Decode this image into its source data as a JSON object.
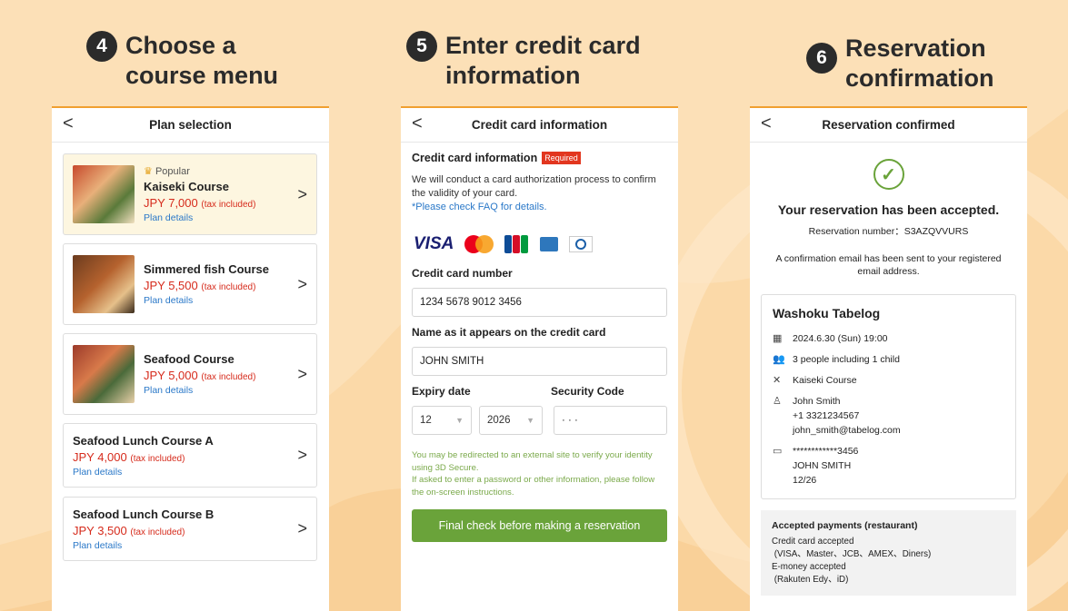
{
  "steps": [
    {
      "num": "4",
      "title": "Choose a\ncourse menu"
    },
    {
      "num": "5",
      "title": "Enter credit card\ninformation"
    },
    {
      "num": "6",
      "title": "Reservation\nconfirmation"
    }
  ],
  "plan_screen": {
    "header": "Plan selection",
    "back_icon": "chevron-left-icon",
    "plans": [
      {
        "badge": "Popular",
        "name": "Kaiseki Course",
        "price": "JPY 7,000",
        "tax": "(tax included)",
        "link": "Plan details"
      },
      {
        "name": "Simmered fish Course",
        "price": "JPY 5,500",
        "tax": "(tax included)",
        "link": "Plan details"
      },
      {
        "name": "Seafood Course",
        "price": "JPY 5,000",
        "tax": "(tax included)",
        "link": "Plan details"
      },
      {
        "name": "Seafood Lunch Course A",
        "price": "JPY 4,000",
        "tax": "(tax included)",
        "link": "Plan details"
      },
      {
        "name": "Seafood Lunch Course B",
        "price": "JPY 3,500",
        "tax": "(tax included)",
        "link": "Plan details"
      }
    ]
  },
  "card_screen": {
    "header": "Credit card information",
    "section_title": "Credit card information",
    "required": "Required",
    "desc": "We will conduct a card authorization process to confirm the validity of your card.",
    "faq": "*Please check FAQ for details.",
    "visa": "VISA",
    "number_label": "Credit card number",
    "number_value": "1234 5678 9012 3456",
    "name_label": "Name as it appears on the credit card",
    "name_value": "JOHN SMITH",
    "expiry_label": "Expiry date",
    "security_label": "Security Code",
    "month": "12",
    "year": "2026",
    "security_value": "· · ·",
    "note": "You may be redirected to an external site to verify your identity using 3D Secure.\nIf asked to enter a password or other information, please follow the on-screen instructions.",
    "button": "Final check before making a reservation"
  },
  "confirm_screen": {
    "header": "Reservation confirmed",
    "headline": "Your reservation has been accepted.",
    "reservation_number": "Reservation number：S3AZQVVURS",
    "mail_note": "A confirmation email has been sent to your registered email address.",
    "restaurant": "Washoku Tabelog",
    "datetime": "2024.6.30 (Sun) 19:00",
    "people": "3 people including 1 child",
    "course": "Kaiseki Course",
    "contact": "John Smith\n+1 3321234567\njohn_smith@tabelog.com",
    "card": "************3456\nJOHN SMITH\n12/26",
    "payments_title": "Accepted payments (restaurant)",
    "payments_text": "Credit card accepted\n (VISA、Master、JCB、AMEX、Diners)\nE-money accepted\n (Rakuten Edy、iD)"
  },
  "colors": {
    "accent": "#6aa33a",
    "price": "#d62b1c",
    "link": "#2a78c8",
    "background": "#fbd9a8"
  }
}
